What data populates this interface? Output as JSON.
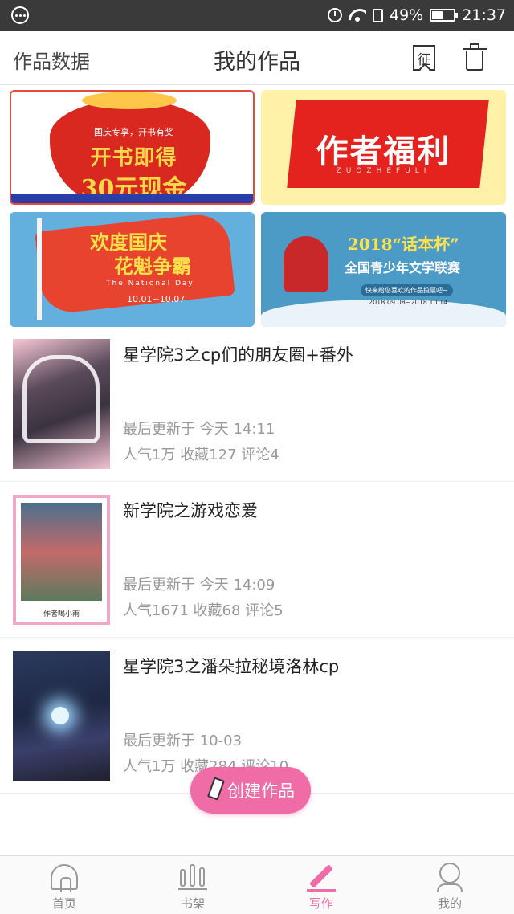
{
  "status_bar": {
    "battery": "49%",
    "battery_level": 0.49,
    "time": "21:37"
  },
  "header": {
    "left_label": "作品数据",
    "title": "我的作品",
    "zheng_icon_text": "征"
  },
  "banners": [
    {
      "name": "guoqing-zhuanxiang",
      "line1": "国庆专享，开书有奖",
      "line2": "开书即得",
      "line3": "30元现金"
    },
    {
      "name": "zuozhe-fuli",
      "line1": "作者福利",
      "line2": "ZUOZHEFULI"
    },
    {
      "name": "huandu-guoqing",
      "line1": "欢度国庆",
      "line2": "花魁争霸",
      "line3": "The National Day",
      "line4": "10.01~10.07"
    },
    {
      "name": "huabenbei",
      "line1": "2018“话本杯”",
      "line2": "全国青少年文学联赛",
      "line3": "快来给您喜欢的作品投票吧~",
      "line4": "2018.09.08~2018.10.14"
    }
  ],
  "works": [
    {
      "title": "星学院3之cp们的朋友圈+番外",
      "updated": "最后更新于 今天 14:11",
      "stats": "人气1万 收藏127 评论4"
    },
    {
      "title": "新学院之游戏恋爱",
      "updated": "最后更新于 今天 14:09",
      "stats": "人气1671 收藏68 评论5",
      "cover_caption": "作者喝小雨"
    },
    {
      "title": "星学院3之潘朵拉秘境洛林cp",
      "updated": "最后更新于 10-03",
      "stats": "人气1万 收藏284 评论10"
    }
  ],
  "create_button": {
    "label": "创建作品"
  },
  "bottom_nav": [
    {
      "label": "首页",
      "icon": "home-icon"
    },
    {
      "label": "书架",
      "icon": "bookshelf-icon"
    },
    {
      "label": "写作",
      "icon": "pencil-icon",
      "active": true
    },
    {
      "label": "我的",
      "icon": "profile-icon"
    }
  ],
  "colors": {
    "accent": "#f06ca6",
    "status_bar": "#3a3a3a"
  }
}
